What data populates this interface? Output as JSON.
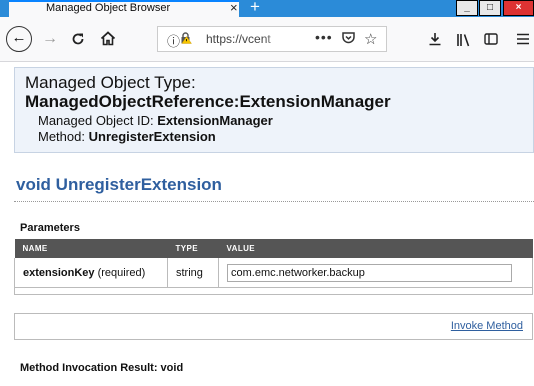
{
  "browser": {
    "tab_title": "Managed Object Browser",
    "tab_close": "×",
    "new_tab": "+",
    "url": "https://vcent",
    "window_controls": {
      "minimize": "_",
      "maximize": "□",
      "close": "×"
    }
  },
  "header": {
    "type_label": "Managed Object Type:",
    "type_value": "ManagedObjectReference:ExtensionManager",
    "id_label": "Managed Object ID:",
    "id_value": "ExtensionManager",
    "method_label": "Method:",
    "method_value": "UnregisterExtension"
  },
  "method": {
    "title": "void UnregisterExtension"
  },
  "parameters": {
    "label": "Parameters",
    "columns": [
      "NAME",
      "TYPE",
      "VALUE"
    ],
    "rows": [
      {
        "name": "extensionKey",
        "qualifier": "(required)",
        "type": "string",
        "value": "com.emc.networker.backup"
      }
    ]
  },
  "invoke": {
    "label": "Invoke Method"
  },
  "result": {
    "label": "Method Invocation Result: void"
  }
}
